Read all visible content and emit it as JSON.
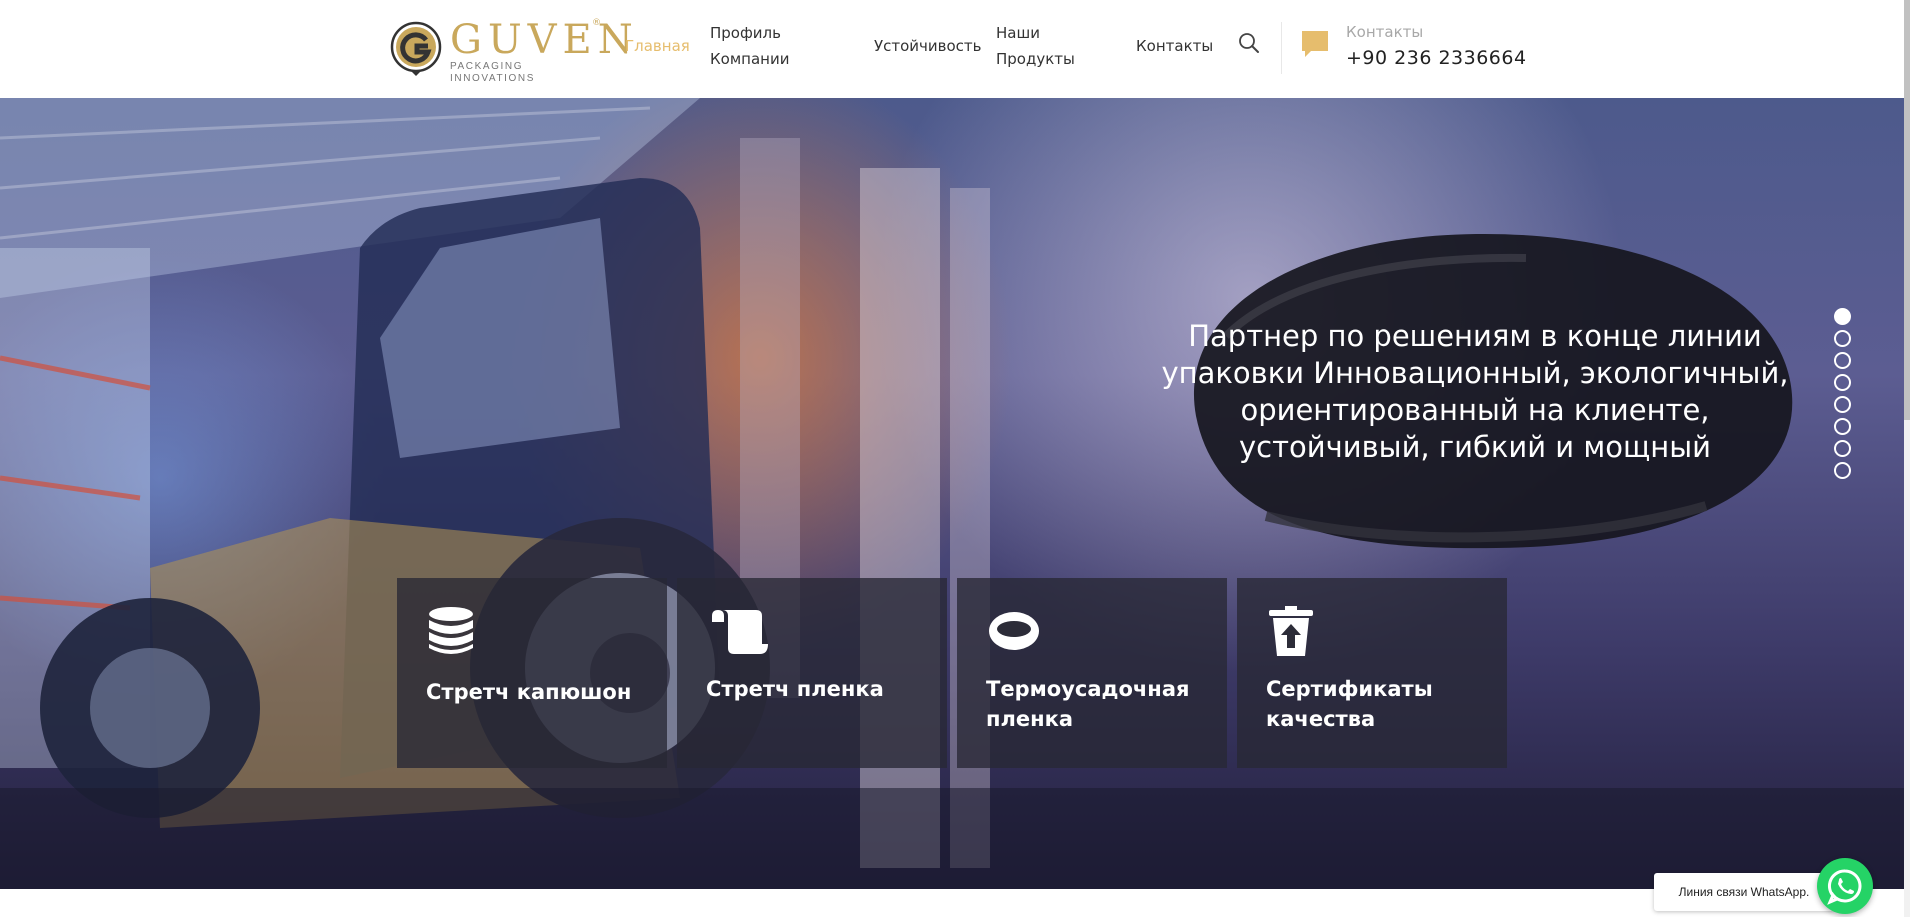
{
  "header": {
    "logo": {
      "name": "GUVEN",
      "tagline": "PACKAGING INNOVATIONS",
      "registered": "®"
    },
    "nav": [
      {
        "label": "Главная",
        "active": true
      },
      {
        "label": "Профиль Компании",
        "line1": "Профиль",
        "line2": "Компании",
        "active": false
      },
      {
        "label": "Устойчивость",
        "active": false
      },
      {
        "label": "Наши Продукты",
        "line1": "Наши",
        "line2": "Продукты",
        "active": false
      },
      {
        "label": "Контакты",
        "active": false
      }
    ],
    "search_icon": "search-icon",
    "contact": {
      "icon": "chat-bubble-icon",
      "label": "Контакты",
      "phone": "+90 236 2336664"
    }
  },
  "hero": {
    "headline_lines": [
      "Партнер по решениям в конце линии",
      "упаковки Инновационный, экологичный,",
      "ориентированный на клиенте,",
      "устойчивый, гибкий и мощный"
    ],
    "slider": {
      "total": 8,
      "active_index": 0
    }
  },
  "categories": [
    {
      "icon": "database-stack-icon",
      "label": "Стретч капюшон"
    },
    {
      "icon": "scroll-icon",
      "label": "Стретч пленка"
    },
    {
      "icon": "ring-icon",
      "label": "Термоусадочная пленка"
    },
    {
      "icon": "recycle-bin-icon",
      "label": "Сертификаты качества"
    }
  ],
  "whatsapp": {
    "label": "Линия связи WhatsApp.",
    "icon": "whatsapp-icon"
  },
  "colors": {
    "accent": "#e6bd6d",
    "logo": "#c9a85c",
    "whatsapp": "#25d366",
    "text": "#333333"
  }
}
